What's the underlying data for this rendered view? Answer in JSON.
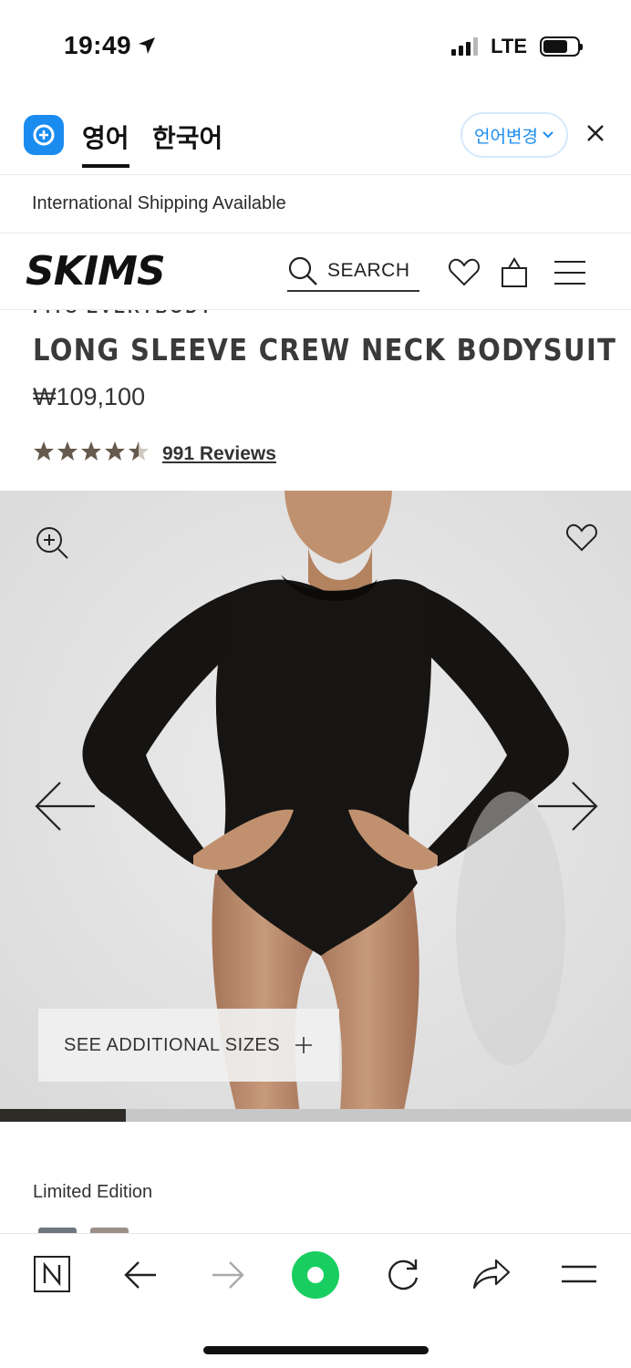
{
  "status_bar": {
    "time": "19:49",
    "network": "LTE"
  },
  "translator": {
    "tabs": [
      {
        "label": "영어",
        "active": true
      },
      {
        "label": "한국어",
        "active": false
      }
    ],
    "change_language_label": "언어변경",
    "accent_color": "#1a8cf0"
  },
  "banner": {
    "text": "International Shipping Available"
  },
  "header": {
    "brand": "SKIMS",
    "search_label": "SEARCH"
  },
  "product": {
    "collection_partial": "FITS EVERYBODY",
    "title": "LONG SLEEVE CREW NECK BODYSUIT",
    "price": "₩109,100",
    "rating": 4.5,
    "reviews_label": "991 Reviews"
  },
  "gallery": {
    "sizes_button_label": "SEE ADDITIONAL SIZES",
    "progress_fraction": 0.2,
    "colors": {
      "background": "#e3e3e3",
      "garment": "#171513",
      "skin": "#b98a6c"
    }
  },
  "limited_label": "Limited Edition",
  "swatches": [
    "#6f7780",
    "#9b8f88"
  ],
  "toolbar": {
    "items": [
      "naver-n-icon",
      "back-arrow-icon",
      "forward-arrow-icon",
      "green-home-icon",
      "reload-icon",
      "share-icon",
      "menu-icon"
    ],
    "green_color": "#19ce60"
  }
}
